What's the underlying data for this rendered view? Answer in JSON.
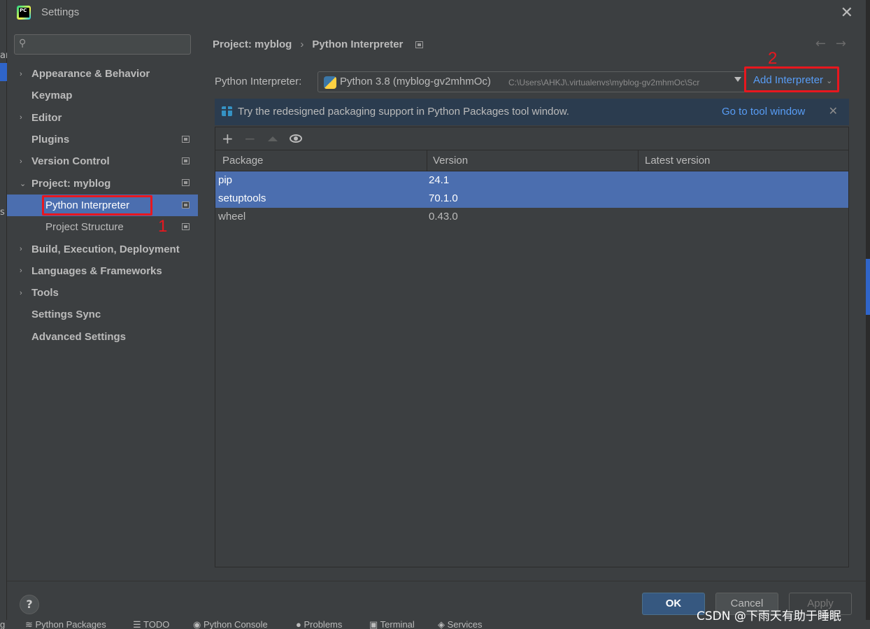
{
  "window": {
    "title": "Settings",
    "close": "✕"
  },
  "colors": {
    "accent": "#589df6",
    "selection": "#4b6eaf",
    "annotation": "#e8171e",
    "background": "#3c3f41"
  },
  "ide_fragments": {
    "left_top": "ar",
    "left_mid": "s"
  },
  "sidebar": {
    "search_placeholder": "",
    "items": [
      {
        "label": "Appearance & Behavior",
        "arrow": "›"
      },
      {
        "label": "Keymap",
        "arrow": ""
      },
      {
        "label": "Editor",
        "arrow": "›"
      },
      {
        "label": "Plugins",
        "arrow": ""
      },
      {
        "label": "Version Control",
        "arrow": "›"
      },
      {
        "label": "Project: myblog",
        "arrow": "⌄"
      },
      {
        "label": "Python Interpreter",
        "arrow": ""
      },
      {
        "label": "Project Structure",
        "arrow": ""
      },
      {
        "label": "Build, Execution, Deployment",
        "arrow": "›"
      },
      {
        "label": "Languages & Frameworks",
        "arrow": "›"
      },
      {
        "label": "Tools",
        "arrow": "›"
      },
      {
        "label": "Settings Sync",
        "arrow": ""
      },
      {
        "label": "Advanced Settings",
        "arrow": ""
      }
    ]
  },
  "breadcrumb": {
    "project": "Project: myblog",
    "separator": "›",
    "page": "Python Interpreter"
  },
  "nav": {
    "back": "←",
    "forward": "→"
  },
  "interpreter": {
    "label": "Python Interpreter:",
    "name": "Python 3.8 (myblog-gv2mhmOc)",
    "path": "C:\\Users\\AHKJ\\.virtualenvs\\myblog-gv2mhmOc\\Scr",
    "add_label": "Add Interpreter",
    "add_chevron": "⌄"
  },
  "banner": {
    "message": "Try the redesigned packaging support in Python Packages tool window.",
    "link": "Go to tool window",
    "close": "✕"
  },
  "toolbar": {
    "add": "+",
    "remove": "−"
  },
  "table": {
    "columns": [
      "Package",
      "Version",
      "Latest version"
    ],
    "rows": [
      {
        "package": "pip",
        "version": "24.1",
        "latest": ""
      },
      {
        "package": "setuptools",
        "version": "70.1.0",
        "latest": ""
      },
      {
        "package": "wheel",
        "version": "0.43.0",
        "latest": ""
      }
    ]
  },
  "footer": {
    "help": "?",
    "ok": "OK",
    "cancel": "Cancel",
    "apply": "Apply"
  },
  "annotations": {
    "one": "1",
    "two": "2"
  },
  "ide_bottom": {
    "frag": "g",
    "python_packages": "Python Packages",
    "todo": "TODO",
    "python_console": "Python Console",
    "problems": "Problems",
    "terminal": "Terminal",
    "services": "Services"
  },
  "watermark": "CSDN @下雨天有助于睡眠"
}
